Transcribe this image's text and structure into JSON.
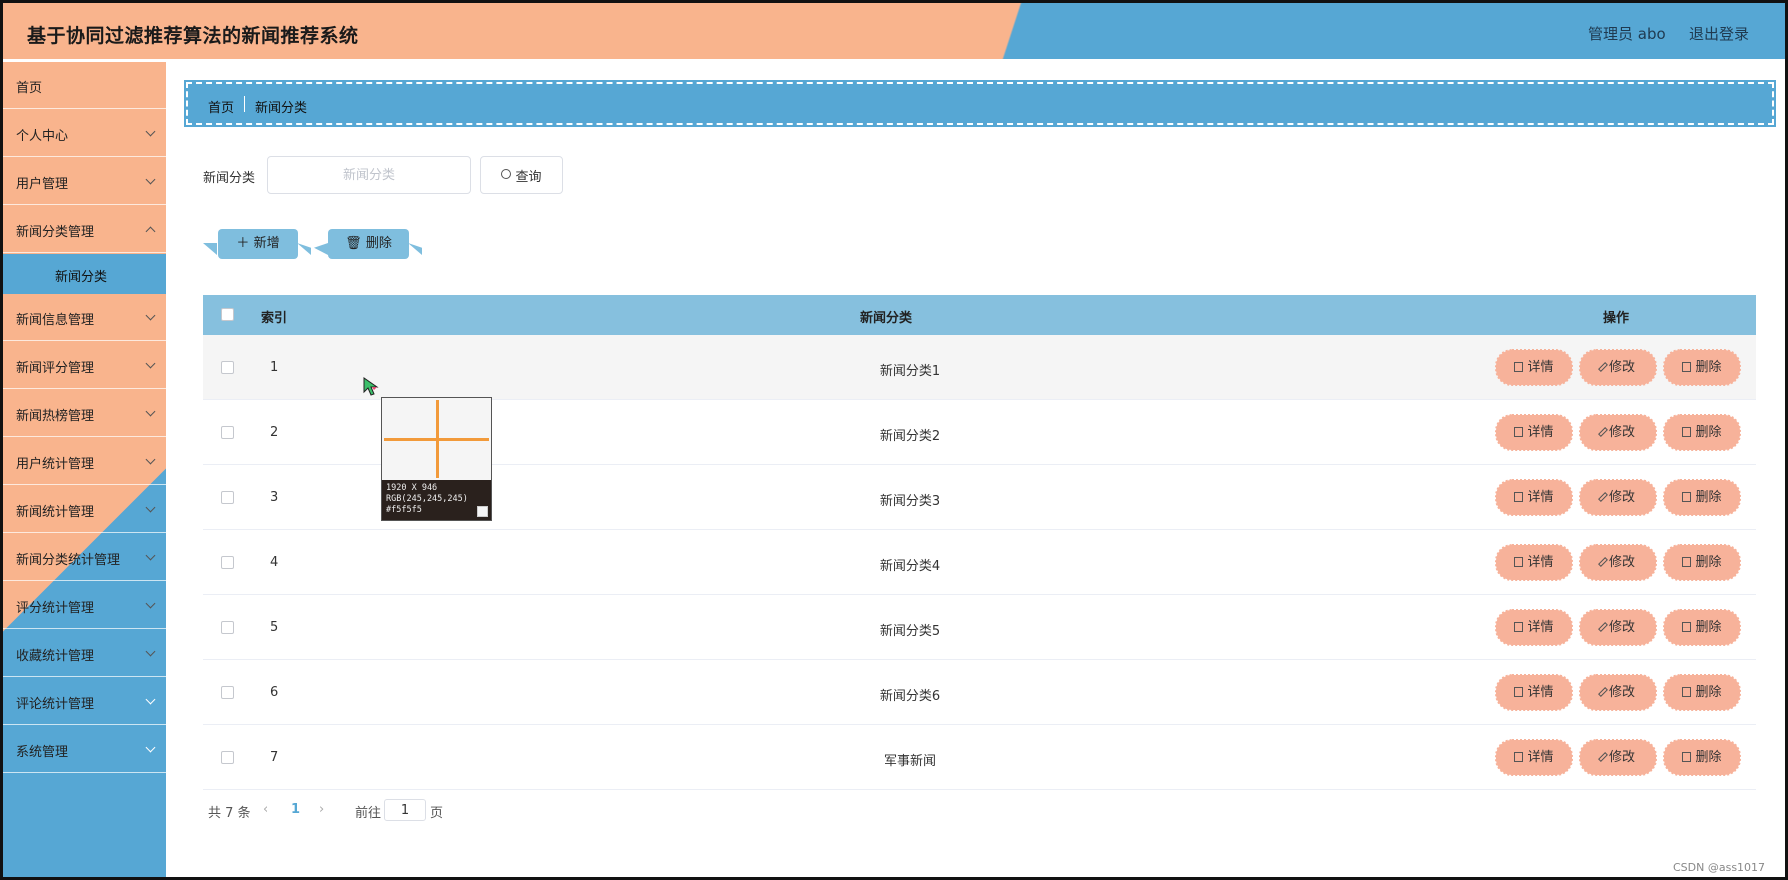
{
  "header": {
    "title": "基于协同过滤推荐算法的新闻推荐系统",
    "user": "管理员 abo",
    "logout": "退出登录"
  },
  "sidebar": {
    "items": [
      {
        "label": "首页",
        "expandable": false
      },
      {
        "label": "个人中心",
        "expandable": true
      },
      {
        "label": "用户管理",
        "expandable": true
      },
      {
        "label": "新闻分类管理",
        "expandable": true
      },
      {
        "label": "新闻信息管理",
        "expandable": true
      },
      {
        "label": "新闻评分管理",
        "expandable": true
      },
      {
        "label": "新闻热榜管理",
        "expandable": true
      },
      {
        "label": "用户统计管理",
        "expandable": true
      },
      {
        "label": "新闻统计管理",
        "expandable": true
      },
      {
        "label": "新闻分类统计管理",
        "expandable": true
      },
      {
        "label": "评分统计管理",
        "expandable": true
      },
      {
        "label": "收藏统计管理",
        "expandable": true
      },
      {
        "label": "评论统计管理",
        "expandable": true
      },
      {
        "label": "系统管理",
        "expandable": true
      }
    ],
    "active_sub": "新闻分类"
  },
  "breadcrumb": {
    "home": "首页",
    "current": "新闻分类"
  },
  "search": {
    "label": "新闻分类",
    "placeholder": "新闻分类",
    "value": "",
    "query_label": "查询"
  },
  "actions": {
    "add_label": "新增",
    "delete_label": "删除"
  },
  "table": {
    "columns": {
      "index": "索引",
      "category": "新闻分类",
      "operations": "操作"
    },
    "rows": [
      {
        "index": "1",
        "category": "新闻分类1"
      },
      {
        "index": "2",
        "category": "新闻分类2"
      },
      {
        "index": "3",
        "category": "新闻分类3"
      },
      {
        "index": "4",
        "category": "新闻分类4"
      },
      {
        "index": "5",
        "category": "新闻分类5"
      },
      {
        "index": "6",
        "category": "新闻分类6"
      },
      {
        "index": "7",
        "category": "军事新闻"
      }
    ],
    "row_actions": {
      "detail": "详情",
      "edit": "修改",
      "delete": "删除"
    }
  },
  "pagination": {
    "total": "共 7 条",
    "prev": "‹",
    "page": "1",
    "next": "›",
    "goto_label": "前往",
    "goto_value": "1",
    "unit": "页"
  },
  "picker": {
    "size": "1920 X 946",
    "rgb": "RGB(245,245,245)",
    "hex": "#f5f5f5"
  },
  "watermark": "CSDN @ass1017",
  "colors": {
    "accent_orange": "#f9b48d",
    "accent_blue": "#56a7d4",
    "table_header": "#86c0de",
    "op_button": "#f7b29a"
  }
}
